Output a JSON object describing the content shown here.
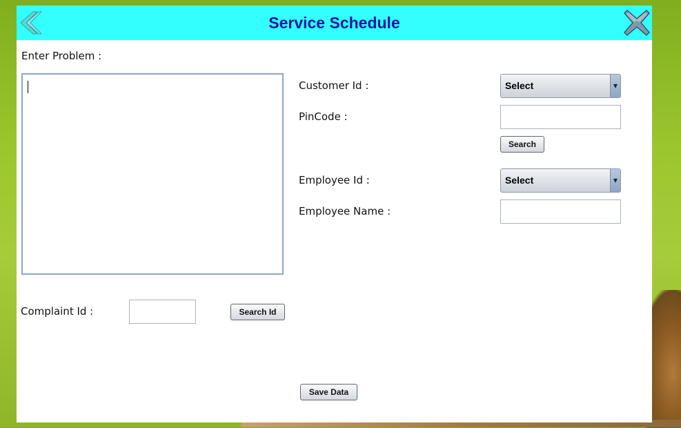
{
  "window": {
    "title": "Service Schedule"
  },
  "icons": {
    "back": "back-arrow-icon",
    "close": "close-x-icon"
  },
  "problem": {
    "label": "Enter Problem :",
    "value": ""
  },
  "complaint": {
    "label": "Complaint Id :",
    "value": "",
    "search_button": "Search Id"
  },
  "customer": {
    "label": "Customer Id :",
    "select_value": "Select",
    "pincode_label": "PinCode :",
    "pincode_value": "",
    "search_button": "Search"
  },
  "employee": {
    "id_label": "Employee Id :",
    "select_value": "Select",
    "name_label": "Employee Name :",
    "name_value": ""
  },
  "footer": {
    "save_button": "Save Data"
  },
  "colors": {
    "titlebar": "#33ffff",
    "title_text": "#0b17a8",
    "window": "#ffffff"
  }
}
